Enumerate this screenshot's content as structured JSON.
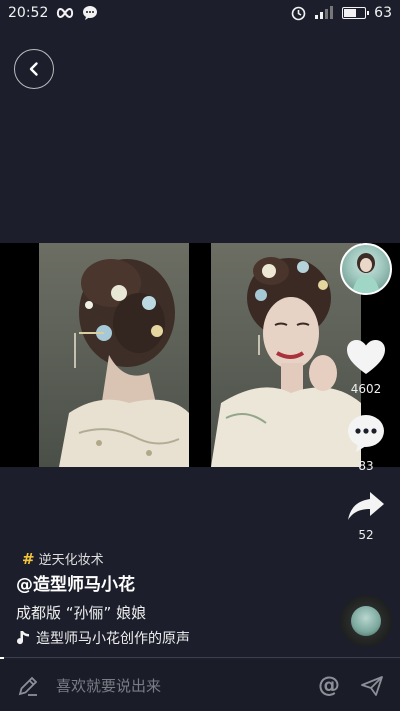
{
  "status_bar": {
    "time": "20:52",
    "battery": "63",
    "battery_level": 0.63
  },
  "actions": {
    "like_count": "4602",
    "comment_count": "83",
    "share_count": "52"
  },
  "info": {
    "topic_symbol": "#",
    "topic": "逆天化妆术",
    "author": "@造型师马小花",
    "description": "成都版 “孙俪” 娘娘",
    "music": "造型师马小花创作的原声"
  },
  "comment_bar": {
    "placeholder": "喜欢就要说出来",
    "at_symbol": "@"
  },
  "playback": {
    "progress": 0.01
  }
}
